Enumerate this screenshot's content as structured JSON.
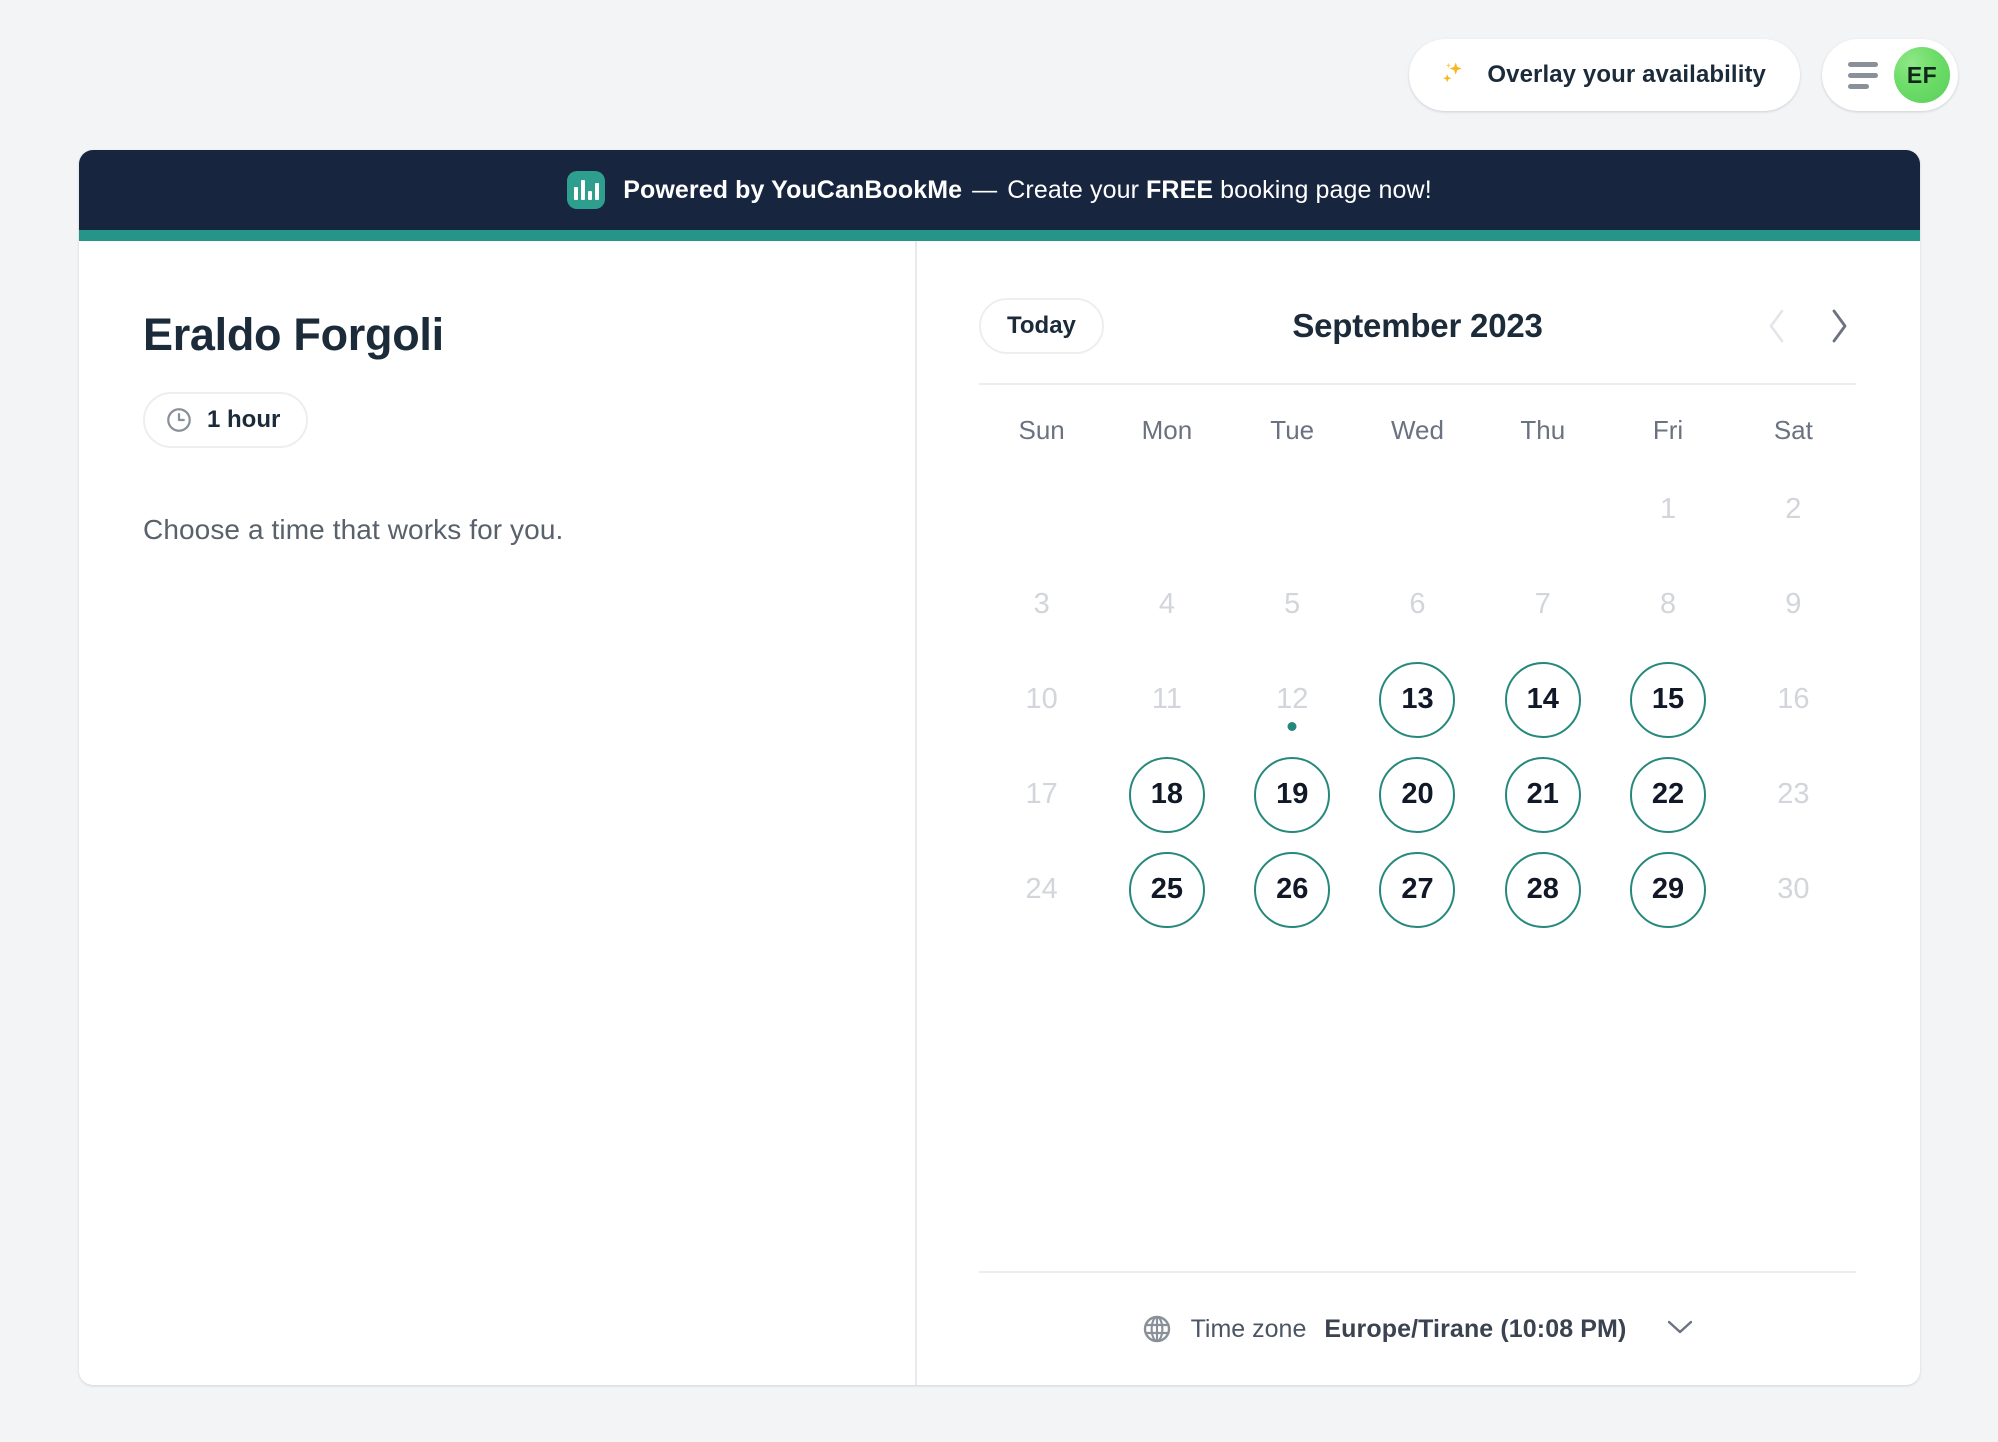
{
  "topbar": {
    "overlay_button": {
      "label": "Overlay your availability",
      "icon": "sparkles-icon"
    },
    "menu_button": {
      "icon": "hamburger-icon"
    },
    "avatar": {
      "initials": "EF",
      "color": "#6fdd6a"
    }
  },
  "promo": {
    "logo_alt": "youcanbookme-logo",
    "prefix": "Powered by YouCanBookMe",
    "dash": "—",
    "cta_pre": "Create your ",
    "cta_bold": "FREE",
    "cta_post": " booking page now!",
    "background": "#18253f",
    "accent": "#269488"
  },
  "left": {
    "host_name": "Eraldo Forgoli",
    "duration": "1 hour",
    "duration_icon": "clock-icon",
    "instruction": "Choose a time that works for you."
  },
  "calendar": {
    "today_label": "Today",
    "month_label": "September 2023",
    "prev_icon": "chevron-left-icon",
    "next_icon": "chevron-right-icon",
    "prev_disabled": true,
    "weekdays": [
      "Sun",
      "Mon",
      "Tue",
      "Wed",
      "Thu",
      "Fri",
      "Sat"
    ],
    "accent_color": "#26887c",
    "today": 12,
    "cells": [
      {
        "num": "",
        "state": "empty"
      },
      {
        "num": "",
        "state": "empty"
      },
      {
        "num": "",
        "state": "empty"
      },
      {
        "num": "",
        "state": "empty"
      },
      {
        "num": "",
        "state": "empty"
      },
      {
        "num": "1",
        "state": "disabled"
      },
      {
        "num": "2",
        "state": "disabled"
      },
      {
        "num": "3",
        "state": "disabled"
      },
      {
        "num": "4",
        "state": "disabled"
      },
      {
        "num": "5",
        "state": "disabled"
      },
      {
        "num": "6",
        "state": "disabled"
      },
      {
        "num": "7",
        "state": "disabled"
      },
      {
        "num": "8",
        "state": "disabled"
      },
      {
        "num": "9",
        "state": "disabled"
      },
      {
        "num": "10",
        "state": "disabled"
      },
      {
        "num": "11",
        "state": "disabled"
      },
      {
        "num": "12",
        "state": "today"
      },
      {
        "num": "13",
        "state": "available"
      },
      {
        "num": "14",
        "state": "available"
      },
      {
        "num": "15",
        "state": "available"
      },
      {
        "num": "16",
        "state": "disabled"
      },
      {
        "num": "17",
        "state": "disabled"
      },
      {
        "num": "18",
        "state": "available"
      },
      {
        "num": "19",
        "state": "available"
      },
      {
        "num": "20",
        "state": "available"
      },
      {
        "num": "21",
        "state": "available"
      },
      {
        "num": "22",
        "state": "available"
      },
      {
        "num": "23",
        "state": "disabled"
      },
      {
        "num": "24",
        "state": "disabled"
      },
      {
        "num": "25",
        "state": "available"
      },
      {
        "num": "26",
        "state": "available"
      },
      {
        "num": "27",
        "state": "available"
      },
      {
        "num": "28",
        "state": "available"
      },
      {
        "num": "29",
        "state": "available"
      },
      {
        "num": "30",
        "state": "disabled"
      }
    ]
  },
  "timezone": {
    "icon": "globe-icon",
    "label": "Time zone",
    "value": "Europe/Tirane (10:08 PM)",
    "caret_icon": "chevron-down-icon"
  }
}
